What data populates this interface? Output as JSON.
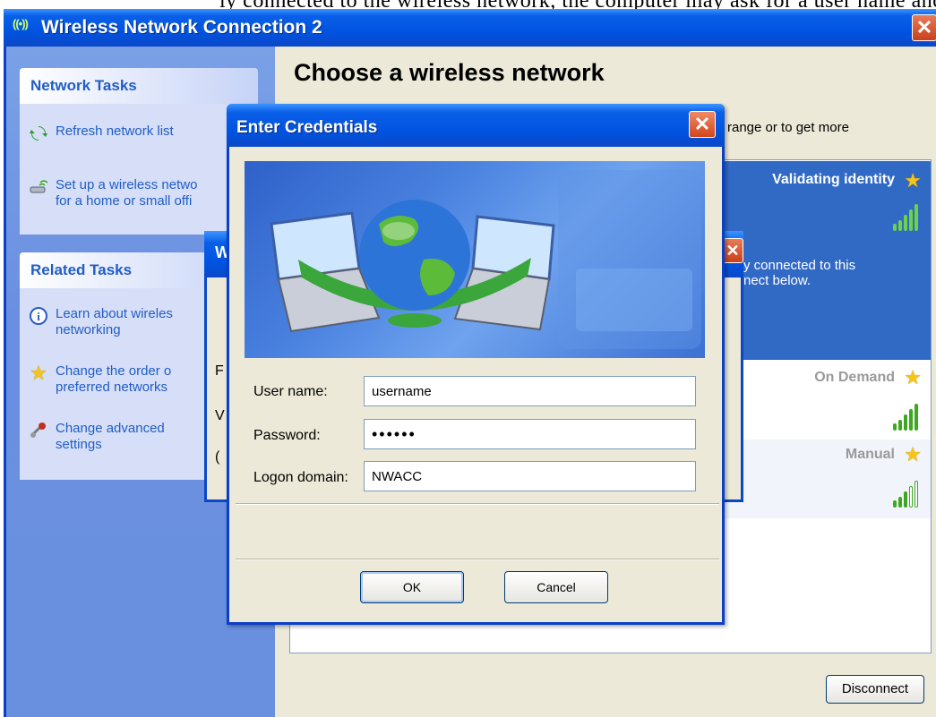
{
  "window": {
    "title": "Wireless Network Connection 2",
    "wifi_glyph": "((•))",
    "close_glyph": "✕"
  },
  "top_strip_text": "ly connected to the wireless network, the computer may ask for a user name and password",
  "left_pane": {
    "network_tasks": {
      "header": "Network Tasks",
      "items": [
        {
          "icon": "refresh-icon",
          "label": "Refresh network list"
        },
        {
          "icon": "wireless-setup-icon",
          "label": "Set up a wireless netwo\nfor a home or small offi"
        }
      ]
    },
    "related_tasks": {
      "header": "Related Tasks",
      "items": [
        {
          "icon": "info-icon",
          "label": "Learn about wireles\nnetworking"
        },
        {
          "icon": "star-icon",
          "label": "Change the order o\npreferred networks"
        },
        {
          "icon": "settings-icon",
          "label": "Change advanced\nsettings"
        }
      ]
    }
  },
  "main": {
    "heading": "Choose a wireless network",
    "intro_fragment": "range or to get more",
    "networks": [
      {
        "status": "Validating identity",
        "detail": "y connected to this\nnect below.",
        "selected": true,
        "signal_bars": 5
      },
      {
        "status": "On Demand",
        "signal_bars": 5
      },
      {
        "status": "Manual",
        "signal_bars": 3
      }
    ],
    "disconnect_label": "Disconnect"
  },
  "hidden_dialog": {
    "title_fragment": "W",
    "close_glyph": "✕",
    "letters": [
      "F",
      "V",
      "("
    ]
  },
  "credentials": {
    "title": "Enter Credentials",
    "close_glyph": "✕",
    "username_label": "User name:",
    "username_value": "username",
    "password_label": "Password:",
    "password_value": "••••••",
    "domain_label": "Logon domain:",
    "domain_value": "NWACC",
    "ok_label": "OK",
    "cancel_label": "Cancel"
  },
  "colors": {
    "titlebar": "#0053e0",
    "selected_row": "#316ac5",
    "task_link": "#215dc6",
    "signal_green": "#3ca81d",
    "star_gold": "#f6c518"
  }
}
